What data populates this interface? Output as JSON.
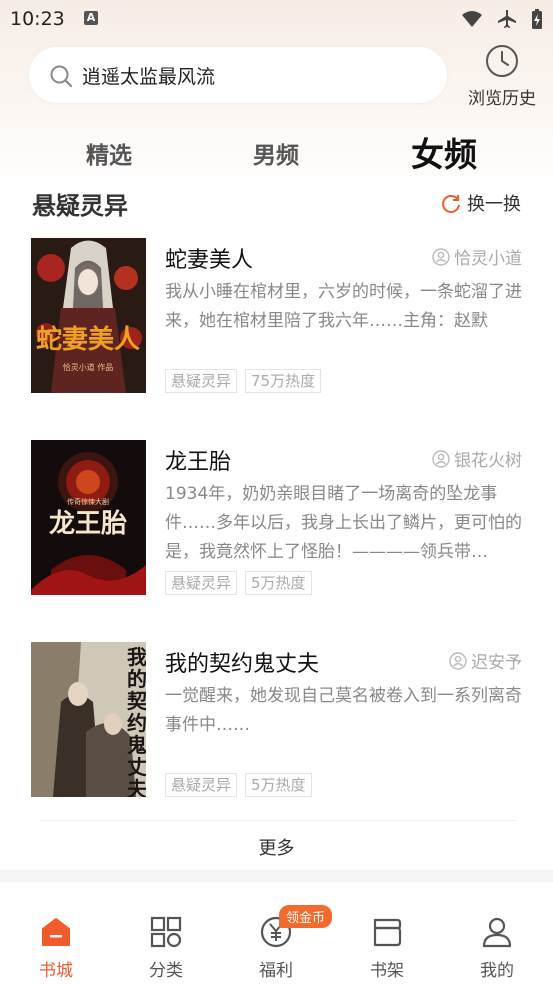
{
  "status_bar": {
    "time": "10:23",
    "notification_icon": "A"
  },
  "search": {
    "value": "逍遥太监最风流"
  },
  "history": {
    "label": "浏览历史"
  },
  "tabs": [
    {
      "label": "精选"
    },
    {
      "label": "男频"
    },
    {
      "label": "女频"
    }
  ],
  "section": {
    "title": "悬疑灵异",
    "refresh_label": "换一换"
  },
  "books": [
    {
      "title": "蛇妻美人",
      "author": "恰灵小道",
      "desc": "我从小睡在棺材里，六岁的时候，一条蛇溜了进来，她在棺材里陪了我六年……主角：赵默",
      "tags": [
        "悬疑灵异",
        "75万热度"
      ],
      "cover_text": "蛇妻美人",
      "cover_sub": "恰灵小道 作品"
    },
    {
      "title": "龙王胎",
      "author": "银花火树",
      "desc": "1934年，奶奶亲眼目睹了一场离奇的坠龙事件……多年以后，我身上长出了鳞片，更可怕的是，我竟然怀上了怪胎！————领兵带…",
      "tags": [
        "悬疑灵异",
        "5万热度"
      ],
      "cover_text": "龙王胎",
      "cover_sub": "传奇惊悚大剧"
    },
    {
      "title": "我的契约鬼丈夫",
      "author": "迟安予",
      "desc": "一觉醒来，她发现自己莫名被卷入到一系列离奇事件中……",
      "tags": [
        "悬疑灵异",
        "5万热度"
      ],
      "cover_text": "我的契约鬼丈夫"
    }
  ],
  "more_label": "更多",
  "nav": [
    {
      "label": "书城",
      "active": true
    },
    {
      "label": "分类"
    },
    {
      "label": "福利",
      "badge": "领金币"
    },
    {
      "label": "书架"
    },
    {
      "label": "我的"
    }
  ],
  "colors": {
    "accent": "#f15a2a",
    "muted": "#888888"
  }
}
